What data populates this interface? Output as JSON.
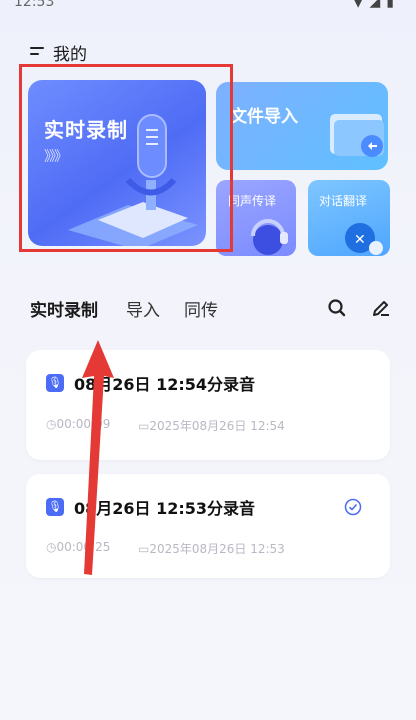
{
  "status_bar": {
    "time": "12:53",
    "icons": "▼◢▮"
  },
  "header": {
    "title": "我的"
  },
  "cards": {
    "realtime": {
      "label": "实时录制",
      "arrows": "》》》"
    },
    "import": {
      "label": "文件导入"
    },
    "simul": {
      "label": "同声传译"
    },
    "dialogue": {
      "label": "对话翻译"
    }
  },
  "tabs": [
    {
      "label": "实时录制"
    },
    {
      "label": "导入"
    },
    {
      "label": "同传"
    }
  ],
  "records": [
    {
      "title": "08月26日 12:54分录音",
      "duration": "00:00:09",
      "date": "2025年08月26日 12:54"
    },
    {
      "title": "08月26日 12:53分录音",
      "duration": "00:00:25",
      "date": "2025年08月26日 12:53"
    }
  ],
  "colors": {
    "accent": "#4d6cf6",
    "annotation_red": "#e53935"
  }
}
